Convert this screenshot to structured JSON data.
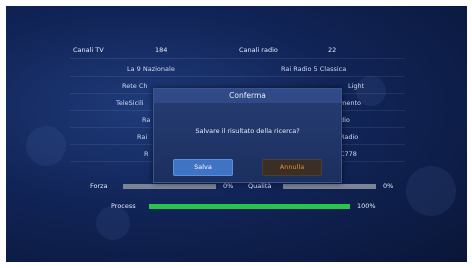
{
  "header": {
    "tv_label": "Canali TV",
    "tv_count": "184",
    "radio_label": "Canali radio",
    "radio_count": "22"
  },
  "channels_tv": [
    "La 9 Nazionale",
    "Rete Ch",
    "TeleSicili",
    "Ra",
    "Rai",
    "R"
  ],
  "channels_radio": [
    "Rai Radio 5 Classica",
    "Light",
    "mento",
    "dio",
    "Radio",
    "C778"
  ],
  "dialog": {
    "title": "Conferma",
    "message": "Salvare il risultato della ricerca?",
    "ok_label": "Salva",
    "cancel_label": "Annulla"
  },
  "signal": {
    "strength_label": "Forza",
    "strength_value": "0%",
    "strength_level": 0,
    "quality_label": "Qualità",
    "quality_value": "0%",
    "quality_level": 0,
    "process_label": "Process",
    "process_value": "100%",
    "process_level": 100
  },
  "colors": {
    "progress": "#27c44e",
    "accent": "#3f73c4",
    "cancel_text": "#e09038"
  }
}
